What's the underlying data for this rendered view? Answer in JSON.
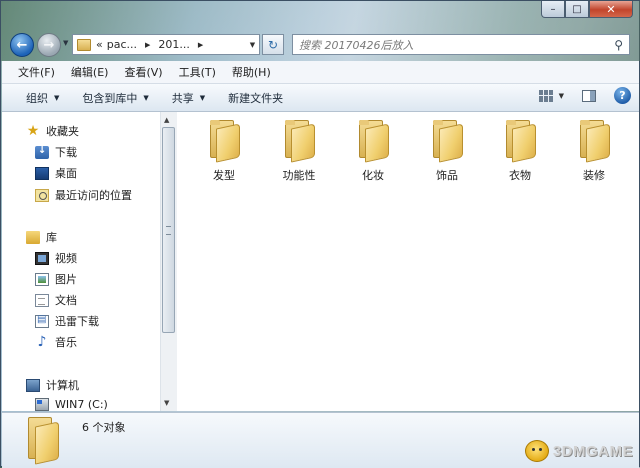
{
  "address": {
    "overflow": "«",
    "segments": [
      "pac...",
      "201..."
    ],
    "refresh_symbol": "↻"
  },
  "search": {
    "placeholder": "搜索 20170426后放入",
    "icon": "search-icon"
  },
  "caption": {
    "minimize": "–",
    "maximize": "□",
    "close": "✕"
  },
  "menu": [
    "文件(F)",
    "编辑(E)",
    "查看(V)",
    "工具(T)",
    "帮助(H)"
  ],
  "toolbar": {
    "organize": "组织",
    "include_in_library": "包含到库中",
    "share": "共享",
    "new_folder": "新建文件夹",
    "help": "?"
  },
  "nav": {
    "favorites": {
      "label": "收藏夹",
      "items": [
        "下载",
        "桌面",
        "最近访问的位置"
      ]
    },
    "libraries": {
      "label": "库",
      "items": [
        "视频",
        "图片",
        "文档",
        "迅雷下载",
        "音乐"
      ]
    },
    "computer": {
      "label": "计算机",
      "items": [
        "WIN7 (C:)"
      ]
    }
  },
  "folders": [
    "发型",
    "功能性",
    "化妆",
    "饰品",
    "衣物",
    "装修"
  ],
  "details": {
    "count": "6 个对象"
  },
  "watermark": {
    "text": "3DMGAME"
  },
  "colors": {
    "accent": "#1d63b8",
    "folder": "#f0cf6e",
    "close": "#c2452c"
  }
}
